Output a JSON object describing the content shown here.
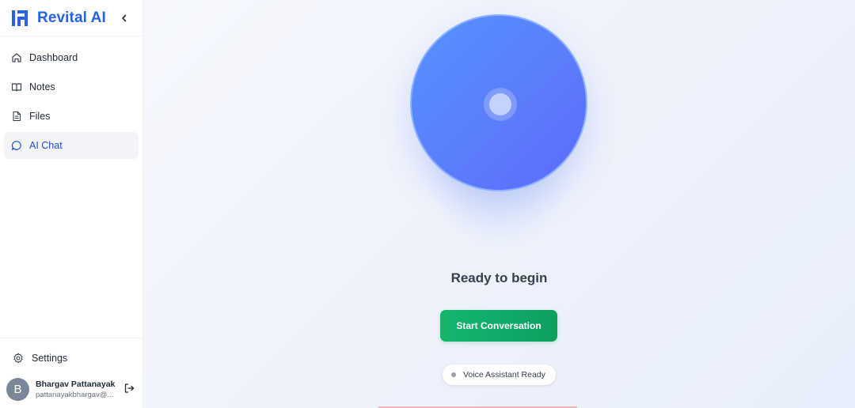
{
  "sidebar": {
    "brand": "Revital AI",
    "nav": [
      {
        "label": "Dashboard",
        "icon": "home-icon",
        "active": false
      },
      {
        "label": "Notes",
        "icon": "book-icon",
        "active": false
      },
      {
        "label": "Files",
        "icon": "file-icon",
        "active": false
      },
      {
        "label": "AI Chat",
        "icon": "chat-bubble-icon",
        "active": true
      }
    ],
    "settings_label": "Settings",
    "user": {
      "initial": "B",
      "name": "Bhargav Pattanayak",
      "email": "pattanayakbhargav@..."
    }
  },
  "main": {
    "status_title": "Ready to begin",
    "start_button": "Start Conversation",
    "badge_text": "Voice Assistant Ready"
  },
  "colors": {
    "brand": "#2563eb",
    "orb": "#5b7dfb",
    "start_button": "#12b76a",
    "active_nav_text": "#1d4ed8"
  }
}
